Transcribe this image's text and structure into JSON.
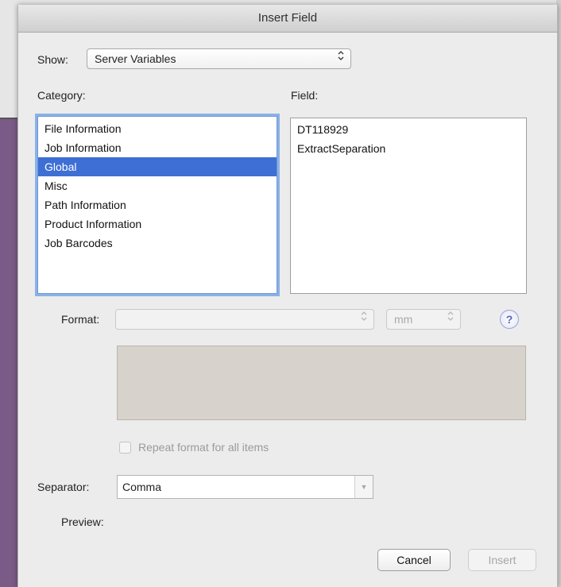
{
  "dialog": {
    "title": "Insert Field"
  },
  "show": {
    "label": "Show:",
    "value": "Server Variables"
  },
  "category": {
    "label": "Category:",
    "items": [
      "File Information",
      "Job Information",
      "Global",
      "Misc",
      "Path Information",
      "Product Information",
      "Job Barcodes"
    ],
    "selected": "Global"
  },
  "field": {
    "label": "Field:",
    "items": [
      "DT118929",
      "ExtractSeparation"
    ]
  },
  "format": {
    "label": "Format:",
    "value": "",
    "unit": "mm",
    "help_symbol": "?"
  },
  "repeat": {
    "label": "Repeat format for all items",
    "checked": false
  },
  "separator": {
    "label": "Separator:",
    "value": "Comma"
  },
  "preview": {
    "label": "Preview:"
  },
  "buttons": {
    "cancel": "Cancel",
    "insert": "Insert"
  },
  "icons": {
    "popup_arrows": "⌃⌄",
    "combo_arrow": "▼"
  }
}
